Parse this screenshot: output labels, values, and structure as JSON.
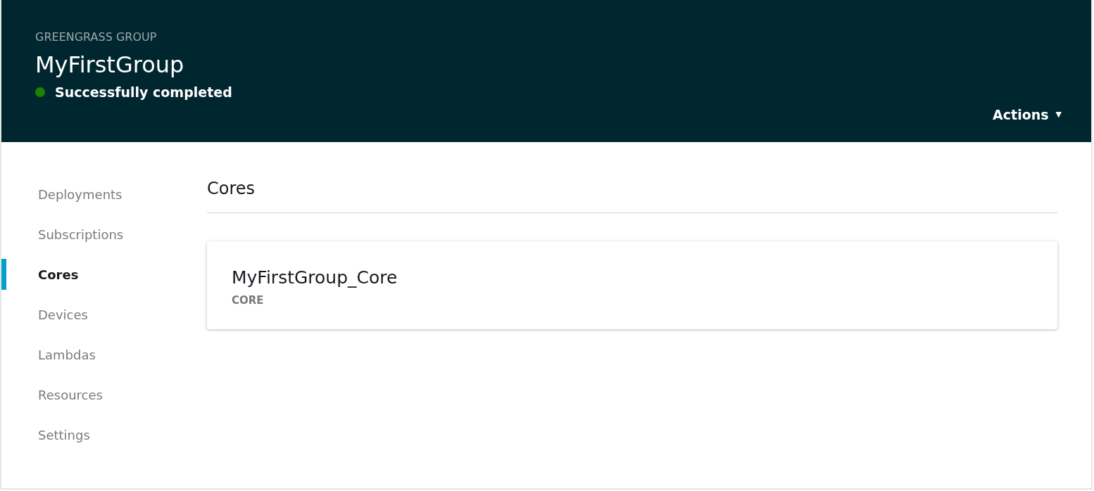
{
  "header": {
    "eyebrow": "GREENGRASS GROUP",
    "title": "MyFirstGroup",
    "status": {
      "text": "Successfully completed",
      "color": "#1d8102"
    },
    "actions": {
      "label": "Actions",
      "caret": "▼"
    }
  },
  "sidebar": {
    "items": [
      {
        "label": "Deployments",
        "selected": false
      },
      {
        "label": "Subscriptions",
        "selected": false
      },
      {
        "label": "Cores",
        "selected": true
      },
      {
        "label": "Devices",
        "selected": false
      },
      {
        "label": "Lambdas",
        "selected": false
      },
      {
        "label": "Resources",
        "selected": false
      },
      {
        "label": "Settings",
        "selected": false
      }
    ]
  },
  "main": {
    "heading": "Cores",
    "cards": [
      {
        "name": "MyFirstGroup_Core",
        "type": "CORE"
      }
    ]
  }
}
